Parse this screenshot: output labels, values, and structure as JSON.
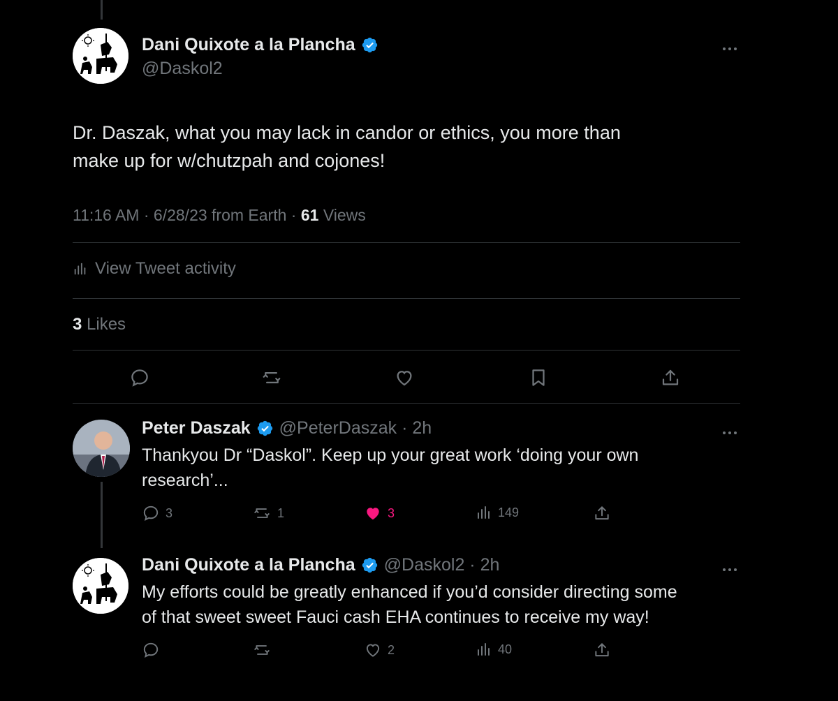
{
  "main_tweet": {
    "author_name": "Dani Quixote a la Plancha",
    "handle": "@Daskol2",
    "text_line1": "Dr. Daszak, what you may lack in candor or ethics, you more than",
    "text_line2": "make up for w/chutzpah and cojones!",
    "time": "11:16 AM · 6/28/23 from Earth · ",
    "views_count": "61",
    "views_label": " Views",
    "activity_label": "View Tweet activity",
    "likes_count": "3",
    "likes_label": " Likes"
  },
  "replies": [
    {
      "author_name": "Peter Daszak",
      "handle_time": "@PeterDaszak · 2h",
      "text_line1": "Thankyou Dr “Daskol”. Keep up your great work ‘doing your own",
      "text_line2": "research’...",
      "reply_count": "3",
      "retweet_count": "1",
      "like_count": "3",
      "liked": true,
      "view_count": "149"
    },
    {
      "author_name": "Dani Quixote a la Plancha",
      "handle_time": "@Daskol2 · 2h",
      "text_line1": "My efforts could be greatly enhanced if you’d consider directing some",
      "text_line2": "of that sweet sweet Fauci cash EHA continues to receive my way!",
      "reply_count": "",
      "retweet_count": "",
      "like_count": "2",
      "liked": false,
      "view_count": "40"
    }
  ],
  "colors": {
    "background": "#000000",
    "text_primary": "#e7e9ea",
    "text_secondary": "#71767b",
    "verified_blue": "#1d9bf0",
    "like_pink": "#f91880",
    "divider": "#2f3336"
  },
  "icons": [
    "verified-badge-icon",
    "more-icon",
    "analytics-icon",
    "reply-icon",
    "retweet-icon",
    "like-icon",
    "bookmark-icon",
    "share-icon"
  ]
}
